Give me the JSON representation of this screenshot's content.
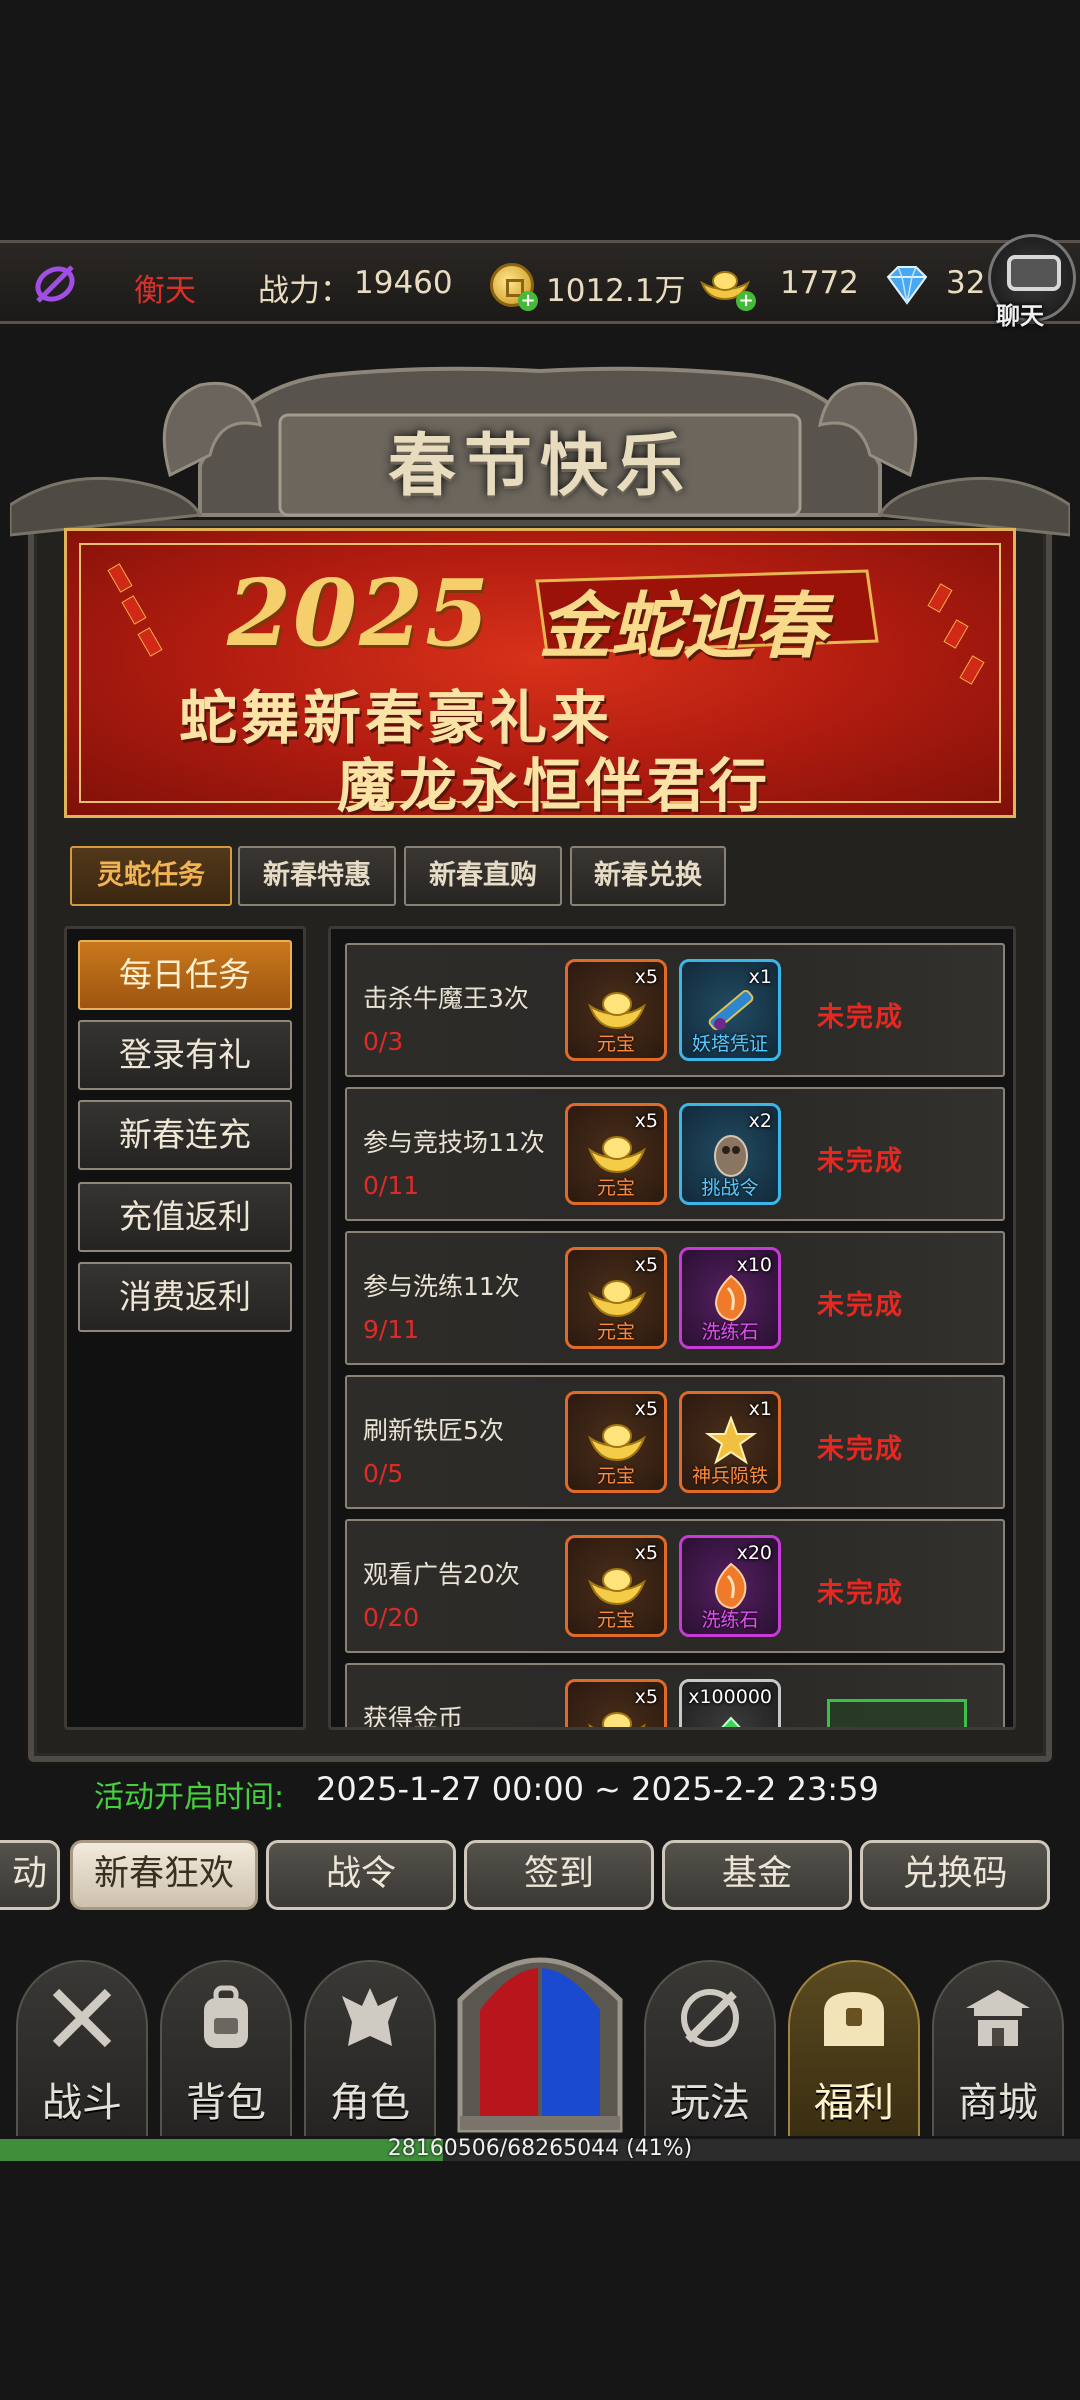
{
  "header": {
    "player_name": "衡天",
    "power_label": "战力：",
    "power_value": "19460",
    "gold": "1012.1万",
    "ingots": "1772",
    "diamonds": "32",
    "chat_label": "聊天"
  },
  "page_title": "春节快乐",
  "banner": {
    "year": "2025",
    "tagline": "金蛇迎春",
    "line1": "蛇舞新春豪礼来",
    "line2": "魔龙永恒伴君行"
  },
  "subtabs": [
    {
      "label": "灵蛇任务",
      "active": true
    },
    {
      "label": "新春特惠",
      "active": false
    },
    {
      "label": "新春直购",
      "active": false
    },
    {
      "label": "新春兑换",
      "active": false
    }
  ],
  "side_menu": [
    {
      "label": "每日任务",
      "active": true
    },
    {
      "label": "登录有礼",
      "active": false
    },
    {
      "label": "新春连充",
      "active": false
    },
    {
      "label": "充值返利",
      "active": false
    },
    {
      "label": "消费返利",
      "active": false
    }
  ],
  "tasks": [
    {
      "name": "击杀牛魔王3次",
      "progress": "0/3",
      "status": "未完成",
      "rewards": [
        {
          "name": "元宝",
          "count": "x5",
          "rarity": "orange",
          "icon": "ingot-icon"
        },
        {
          "name": "妖塔凭证",
          "count": "x1",
          "rarity": "blue",
          "icon": "tower-voucher-icon"
        }
      ]
    },
    {
      "name": "参与竞技场11次",
      "progress": "0/11",
      "status": "未完成",
      "rewards": [
        {
          "name": "元宝",
          "count": "x5",
          "rarity": "orange",
          "icon": "ingot-icon"
        },
        {
          "name": "挑战令",
          "count": "x2",
          "rarity": "blue",
          "icon": "challenge-token-icon"
        }
      ]
    },
    {
      "name": "参与洗练11次",
      "progress": "9/11",
      "status": "未完成",
      "rewards": [
        {
          "name": "元宝",
          "count": "x5",
          "rarity": "orange",
          "icon": "ingot-icon"
        },
        {
          "name": "洗练石",
          "count": "x10",
          "rarity": "purple",
          "icon": "refine-stone-icon"
        }
      ]
    },
    {
      "name": "刷新铁匠5次",
      "progress": "0/5",
      "status": "未完成",
      "rewards": [
        {
          "name": "元宝",
          "count": "x5",
          "rarity": "orange",
          "icon": "ingot-icon"
        },
        {
          "name": "神兵陨铁",
          "count": "x1",
          "rarity": "orange",
          "icon": "meteor-iron-icon"
        }
      ]
    },
    {
      "name": "观看广告20次",
      "progress": "0/20",
      "status": "未完成",
      "rewards": [
        {
          "name": "元宝",
          "count": "x5",
          "rarity": "orange",
          "icon": "ingot-icon"
        },
        {
          "name": "洗练石",
          "count": "x20",
          "rarity": "purple",
          "icon": "refine-stone-icon"
        }
      ]
    },
    {
      "name": "获得金币",
      "progress": "",
      "status": "",
      "rewards": [
        {
          "name": "元宝",
          "count": "x5",
          "rarity": "orange",
          "icon": "ingot-icon"
        },
        {
          "name": "",
          "count": "x100000",
          "rarity": "gray",
          "icon": "gold-coin-icon"
        }
      ]
    }
  ],
  "activity_time": {
    "label": "活动开启时间:",
    "value": "2025-1-27 00:00 ~ 2025-2-2 23:59"
  },
  "event_tabs": [
    {
      "label": "动",
      "active": false
    },
    {
      "label": "新春狂欢",
      "active": true
    },
    {
      "label": "战令",
      "active": false
    },
    {
      "label": "签到",
      "active": false
    },
    {
      "label": "基金",
      "active": false
    },
    {
      "label": "兑换码",
      "active": false
    }
  ],
  "bottom_nav": [
    {
      "label": "战斗",
      "icon": "crossed-swords-icon",
      "active": false
    },
    {
      "label": "背包",
      "icon": "backpack-icon",
      "active": false
    },
    {
      "label": "角色",
      "icon": "character-helmet-icon",
      "active": false
    },
    {
      "label": "玩法",
      "icon": "sword-gameplay-icon",
      "active": false
    },
    {
      "label": "福利",
      "icon": "treasure-chest-icon",
      "active": true
    },
    {
      "label": "商城",
      "icon": "shop-pagoda-icon",
      "active": false
    }
  ],
  "experience": {
    "text": "28160506/68265044 (41%)",
    "fraction": 0.41
  },
  "colors": {
    "accent_gold": "#f2b352",
    "incomplete_red": "#e62822",
    "time_green": "#45d23e",
    "banner_red": "#b11c10"
  }
}
